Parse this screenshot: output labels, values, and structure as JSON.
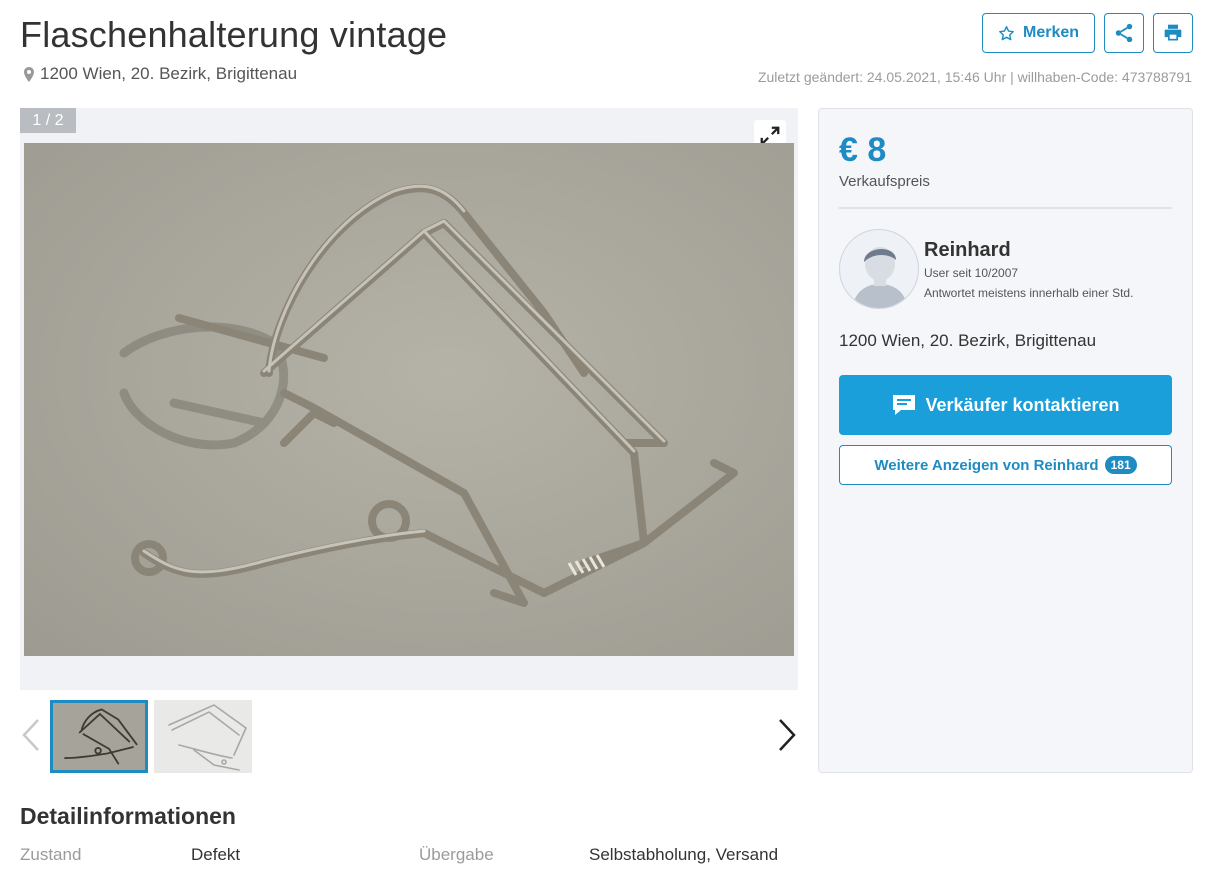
{
  "listing": {
    "title": "Flaschenhalterung vintage",
    "location": "1200 Wien, 20. Bezirk, Brigittenau",
    "meta": "Zuletzt geändert: 24.05.2021, 15:46 Uhr | willhaben-Code: 473788791"
  },
  "actions": {
    "save_label": "Merken",
    "icons": [
      "star-icon",
      "share-icon",
      "print-icon"
    ]
  },
  "gallery": {
    "counter": "1 / 2",
    "thumbnail_count": 2,
    "selected_index": 0
  },
  "sidebar": {
    "price": "€ 8",
    "price_label": "Verkaufspreis",
    "seller": {
      "name": "Reinhard",
      "since": "User seit 10/2007",
      "reply": "Antwortet meistens innerhalb einer Std."
    },
    "location": "1200 Wien, 20. Bezirk, Brigittenau",
    "contact_label": "Verkäufer kontaktieren",
    "more_ads_label": "Weitere Anzeigen von Reinhard",
    "more_ads_count": "181"
  },
  "details": {
    "heading": "Detailinformationen",
    "rows": [
      {
        "label": "Zustand",
        "value": "Defekt"
      },
      {
        "label": "Übergabe",
        "value": "Selbstabholung, Versand"
      }
    ]
  },
  "colors": {
    "accent": "#1e8bc3",
    "contact_button": "#1a9fdb",
    "sidebar_bg": "#f4f6f9"
  }
}
